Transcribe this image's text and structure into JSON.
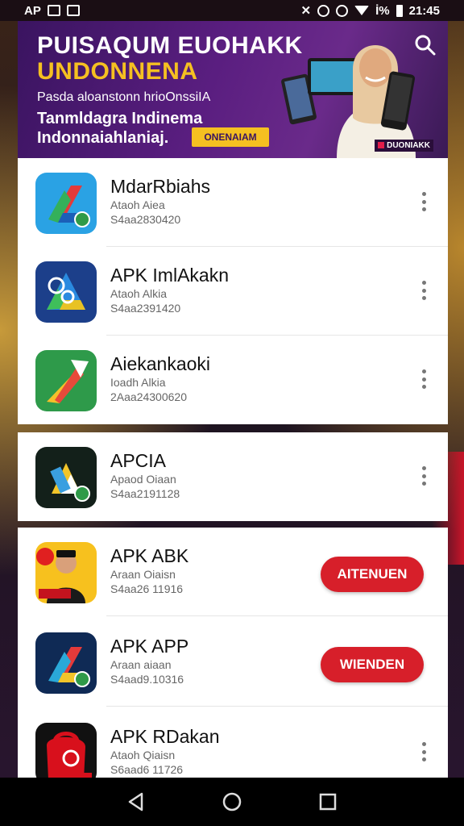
{
  "status_bar": {
    "left_text": "AP",
    "battery_text": "İ%",
    "time": "21:45"
  },
  "banner": {
    "title_line1": "PUISAQUM EUOHAKK",
    "title_line2": "UNDONNENA",
    "subtitle": "Pasda aloanstonn hrioOnssiIA",
    "tagline_line1": "Tanmldagra Indinema",
    "tagline_line2": "Indonnaiahlaniaj.",
    "cta_label": "ONENAIAM",
    "badge_text": "DUONIAKK"
  },
  "apps": [
    {
      "name": "MdarRbiahs",
      "meta1": "Ataoh Aiea",
      "meta2": "S4aa2830420",
      "action": "more",
      "icon": "blue-drive-icon"
    },
    {
      "name": "APK ImlAkakn",
      "meta1": "Ataoh Alkia",
      "meta2": "S4aa2391420",
      "action": "more",
      "icon": "navy-drive-icon"
    },
    {
      "name": "Aiekankaoki",
      "meta1": "Ioadh Alkia",
      "meta2": "2Aaa24300620",
      "action": "more",
      "icon": "green-drive-icon"
    },
    {
      "name": "APCIA",
      "meta1": "Apaod Oiaan",
      "meta2": "S4aa2191128",
      "action": "more",
      "icon": "black-drive-icon"
    },
    {
      "name": "APK ABK",
      "meta1": "Araan Oiaisn",
      "meta2": "S4aa26 11916",
      "action": "install",
      "button_label": "AITENUEN",
      "icon": "person-promo-icon"
    },
    {
      "name": "APK APP",
      "meta1": "Araan aiaan",
      "meta2": "S4aad9.10316",
      "action": "install",
      "button_label": "WIENDEN",
      "icon": "darkblue-drive-icon"
    },
    {
      "name": "APK RDakan",
      "meta1": "Ataoh Qiaisn",
      "meta2": "S6aad6 11726",
      "action": "more",
      "icon": "red-bag-icon"
    }
  ],
  "nav": {
    "back": "back-icon",
    "home": "home-icon",
    "recent": "recent-apps-icon"
  }
}
